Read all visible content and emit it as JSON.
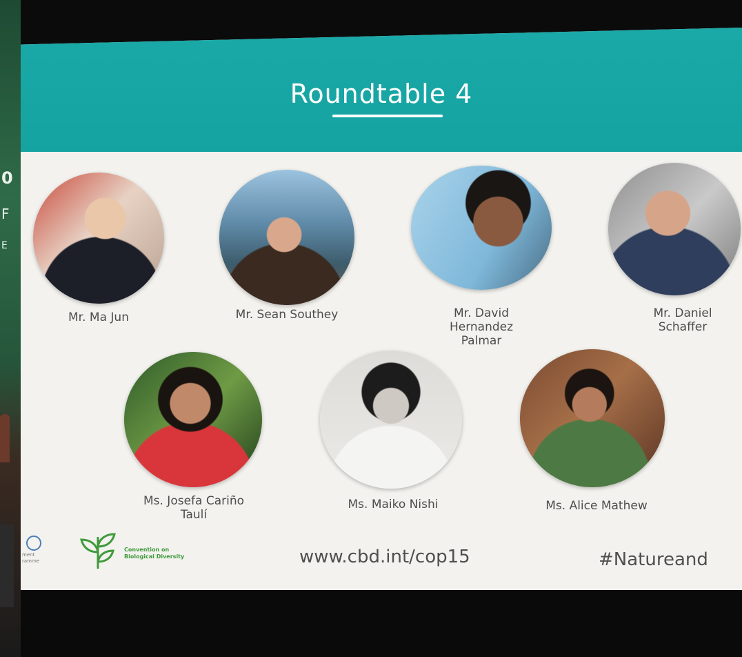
{
  "slide": {
    "title": "Roundtable 4",
    "website": "www.cbd.int/cop15",
    "hashtag": "#Natureand",
    "cbd_logo_text": "Convention on Biological Diversity",
    "unep_logo_text": "ment\nramme"
  },
  "speakers": [
    {
      "name": "Mr. Ma Jun"
    },
    {
      "name": "Mr. Sean Southey"
    },
    {
      "name": "Mr. David\nHernandez\nPalmar"
    },
    {
      "name": "Mr. Daniel\nSchaffer"
    },
    {
      "name": "Ms. Josefa Cariño\nTaulí"
    },
    {
      "name": "Ms. Maiko Nishi"
    },
    {
      "name": "Ms. Alice Mathew"
    }
  ],
  "left_edge": {
    "fragments": [
      "0",
      "F",
      "E"
    ]
  },
  "colors": {
    "banner": "#1ba9a8",
    "slide_bg": "#f3f2ee",
    "cbd_green": "#3f9a3a"
  }
}
